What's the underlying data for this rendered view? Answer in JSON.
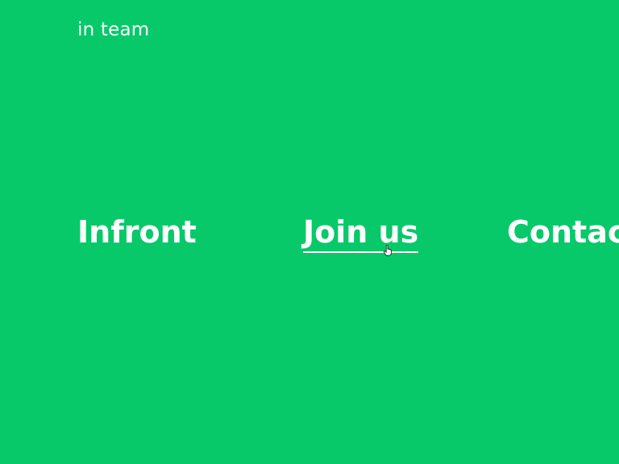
{
  "brand": {
    "logo_text": "in team"
  },
  "nav": {
    "items": [
      {
        "label": "Infront"
      },
      {
        "label": "Join us",
        "state": "hover"
      },
      {
        "label": "Contact"
      }
    ]
  },
  "colors": {
    "background": "#07c969",
    "text": "#ffffff"
  },
  "icons": {
    "cursor": "hand-pointer-icon"
  }
}
